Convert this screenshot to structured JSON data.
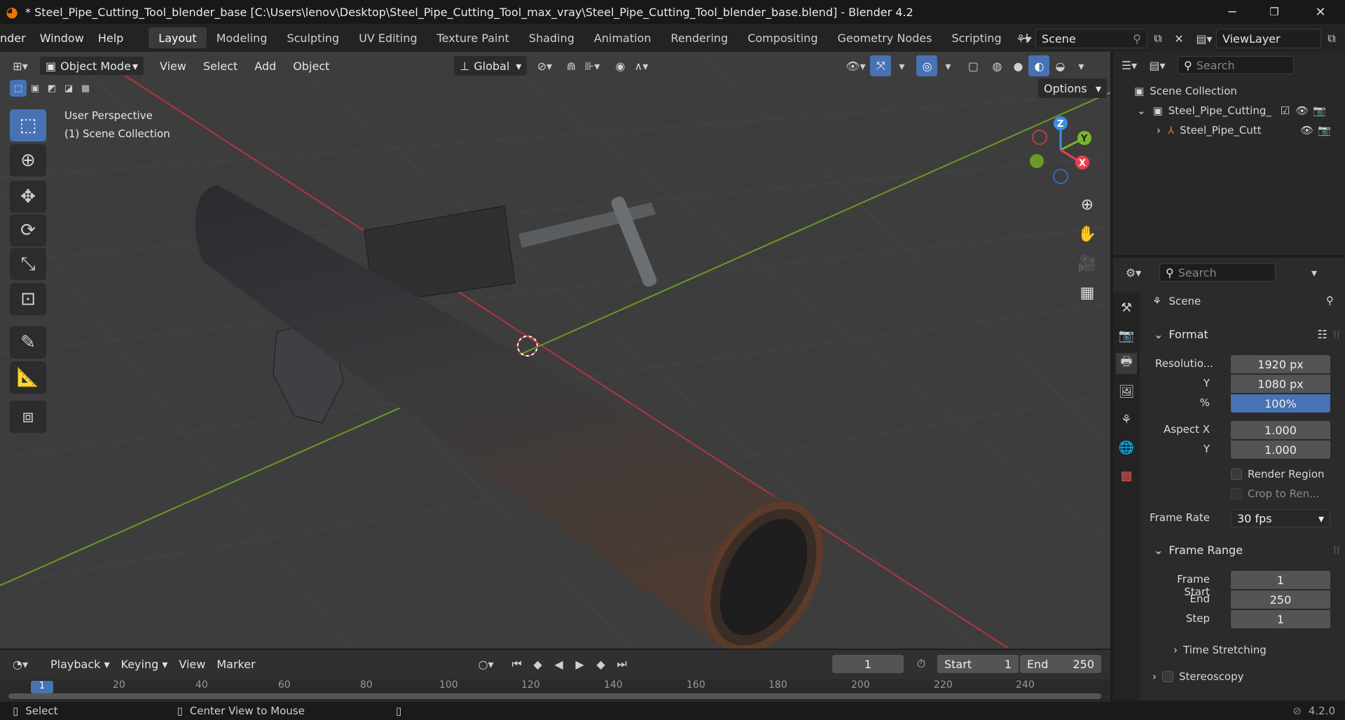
{
  "title": {
    "text": "* Steel_Pipe_Cutting_Tool_blender_base [C:\\Users\\lenov\\Desktop\\Steel_Pipe_Cutting_Tool_max_vray\\Steel_Pipe_Cutting_Tool_blender_base.blend] - Blender 4.2",
    "minimize": "─",
    "maximize": "❐",
    "close": "✕"
  },
  "menu": {
    "items": [
      "nder",
      "Window",
      "Help"
    ]
  },
  "workspaces": [
    "Layout",
    "Modeling",
    "Sculpting",
    "UV Editing",
    "Texture Paint",
    "Shading",
    "Animation",
    "Rendering",
    "Compositing",
    "Geometry Nodes",
    "Scripting"
  ],
  "add_workspace": "+",
  "scene": {
    "name": "Scene",
    "view_layer": "ViewLayer"
  },
  "viewport": {
    "mode": "Object Mode",
    "menu": [
      "View",
      "Select",
      "Add",
      "Object"
    ],
    "orientation": "Global",
    "options": "Options",
    "overlay_line1": "User Perspective",
    "overlay_line2": "(1) Scene Collection",
    "gizmo": {
      "z": "Z",
      "y": "Y",
      "x": "X"
    }
  },
  "outliner": {
    "search_placeholder": "Search",
    "root": "Scene Collection",
    "collection": "Steel_Pipe_Cutting_",
    "object": "Steel_Pipe_Cutt"
  },
  "properties": {
    "search_placeholder": "Search",
    "context": "Scene",
    "format": {
      "title": "Format",
      "res_label": "Resolutio...",
      "res_x": "1920 px",
      "y_label": "Y",
      "res_y": "1080 px",
      "pct_label": "%",
      "pct": "100%",
      "aspect_label": "Aspect X",
      "aspect_x": "1.000",
      "aspect_y_label": "Y",
      "aspect_y": "1.000",
      "render_region": "Render Region",
      "crop": "Crop to Ren...",
      "frame_rate_label": "Frame Rate",
      "frame_rate": "30 fps"
    },
    "frame_range": {
      "title": "Frame Range",
      "start_label": "Frame Start",
      "start": "1",
      "end_label": "End",
      "end": "250",
      "step_label": "Step",
      "step": "1"
    },
    "time_stretching": "Time Stretching",
    "stereoscopy": "Stereoscopy"
  },
  "timeline": {
    "menu": [
      "Playback",
      "Keying",
      "View",
      "Marker"
    ],
    "current": "1",
    "start_label": "Start",
    "start": "1",
    "end_label": "End",
    "end": "250",
    "ticks": [
      "1",
      "20",
      "40",
      "60",
      "80",
      "100",
      "120",
      "140",
      "160",
      "180",
      "200",
      "220",
      "240"
    ]
  },
  "status": {
    "select": "Select",
    "center": "Center View to Mouse",
    "version": "4.2.0"
  },
  "colors": {
    "accent": "#4772b3",
    "x_axis": "#e8404e",
    "y_axis": "#7ab52a",
    "z_axis": "#3d8fe6",
    "blender_orange": "#ea7600"
  }
}
